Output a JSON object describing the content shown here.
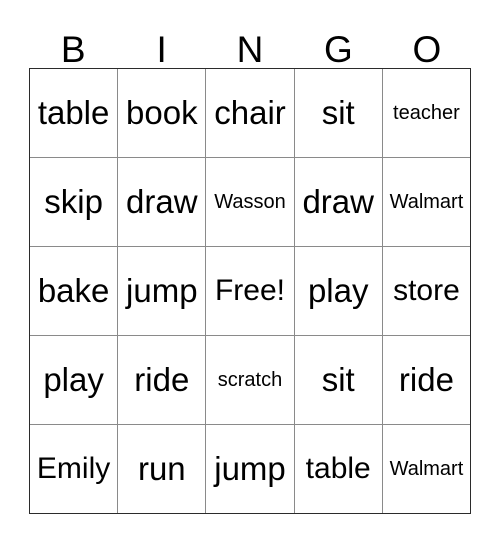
{
  "card": {
    "title": "BINGO",
    "free_space_label": "Free!",
    "header": {
      "letters": [
        "B",
        "I",
        "N",
        "G",
        "O"
      ]
    },
    "grid": {
      "columns": 5,
      "rows": 5,
      "cells": [
        [
          {
            "label": "table",
            "size": "lg"
          },
          {
            "label": "book",
            "size": "lg"
          },
          {
            "label": "chair",
            "size": "lg"
          },
          {
            "label": "sit",
            "size": "lg"
          },
          {
            "label": "teacher",
            "size": "sm"
          }
        ],
        [
          {
            "label": "skip",
            "size": "lg"
          },
          {
            "label": "draw",
            "size": "lg"
          },
          {
            "label": "Wasson",
            "size": "sm"
          },
          {
            "label": "draw",
            "size": "lg"
          },
          {
            "label": "Walmart",
            "size": "sm"
          }
        ],
        [
          {
            "label": "bake",
            "size": "lg"
          },
          {
            "label": "jump",
            "size": "lg"
          },
          {
            "label": "Free!",
            "size": "md"
          },
          {
            "label": "play",
            "size": "lg"
          },
          {
            "label": "store",
            "size": "md"
          }
        ],
        [
          {
            "label": "play",
            "size": "lg"
          },
          {
            "label": "ride",
            "size": "lg"
          },
          {
            "label": "scratch",
            "size": "sm"
          },
          {
            "label": "sit",
            "size": "lg"
          },
          {
            "label": "ride",
            "size": "lg"
          }
        ],
        [
          {
            "label": "Emily",
            "size": "md"
          },
          {
            "label": "run",
            "size": "lg"
          },
          {
            "label": "jump",
            "size": "lg"
          },
          {
            "label": "table",
            "size": "md"
          },
          {
            "label": "Walmart",
            "size": "sm"
          }
        ]
      ]
    },
    "colors": {
      "background": "#ffffff",
      "text": "#000000",
      "outer_border": "#2b2b2b",
      "inner_border": "#8a8a8a"
    }
  }
}
